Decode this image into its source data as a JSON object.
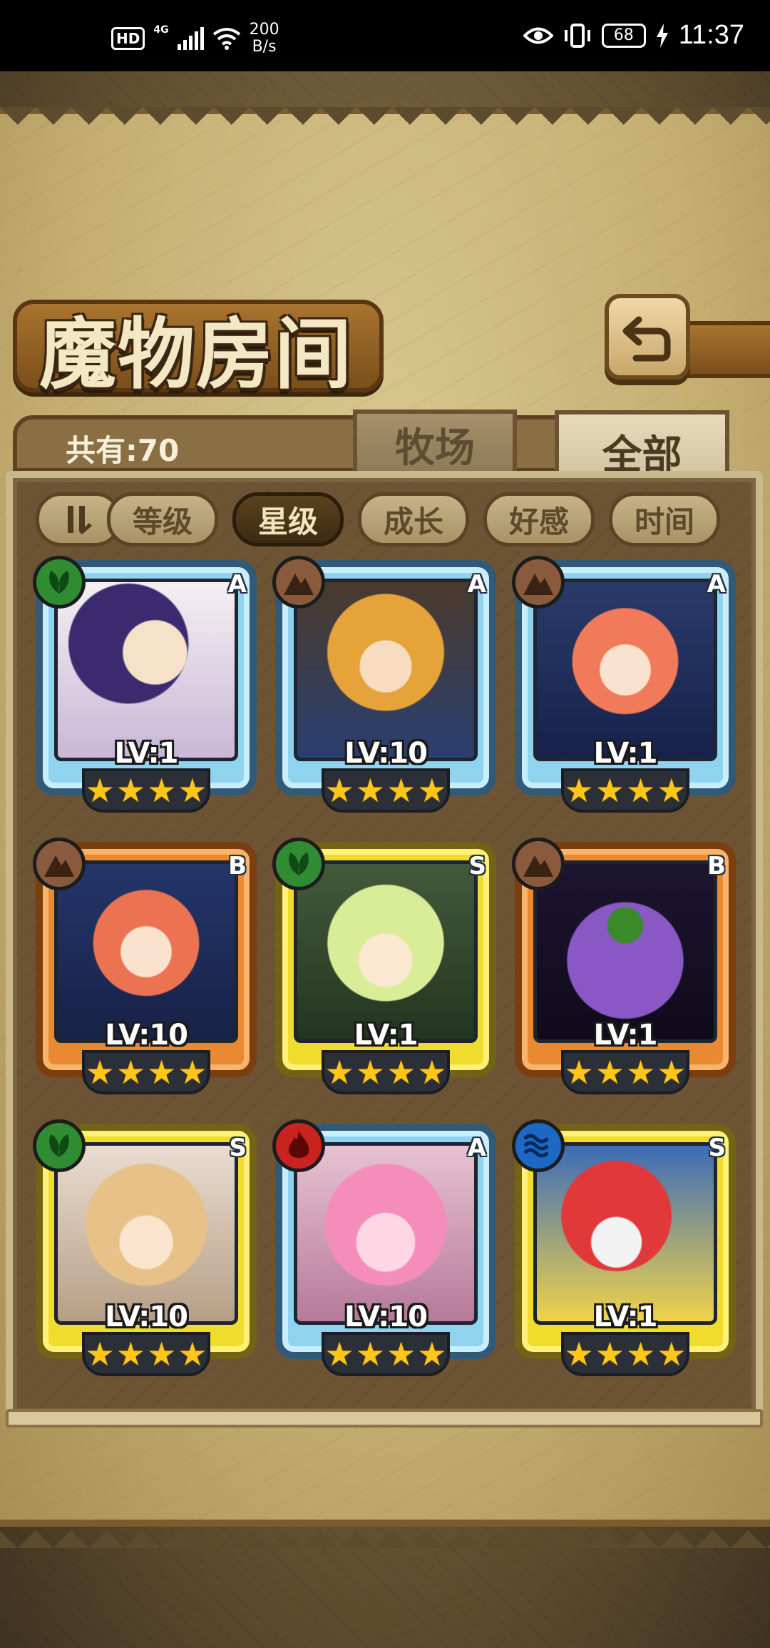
{
  "status_bar": {
    "hd": "HD",
    "network": "4G",
    "speed_value": "200",
    "speed_unit": "B/s",
    "battery": "68",
    "time": "11:37"
  },
  "header": {
    "title": "魔物房间",
    "back_icon": "return-arrow-icon"
  },
  "inventory": {
    "count_label": "共有:70"
  },
  "tabs": [
    {
      "label": "牧场",
      "active": false
    },
    {
      "label": "全部",
      "active": true
    }
  ],
  "sort": {
    "toggle_icon": "sort-order-icon",
    "buttons": [
      {
        "label": "等级",
        "active": false
      },
      {
        "label": "星级",
        "active": true
      },
      {
        "label": "成长",
        "active": false
      },
      {
        "label": "好感",
        "active": false
      },
      {
        "label": "时间",
        "active": false
      }
    ]
  },
  "monsters": [
    {
      "grade": "A",
      "element": "grass",
      "level": "LV:1",
      "stars": 4
    },
    {
      "grade": "A",
      "element": "earth",
      "level": "LV:10",
      "stars": 4
    },
    {
      "grade": "A",
      "element": "earth",
      "level": "LV:1",
      "stars": 4
    },
    {
      "grade": "B",
      "element": "earth",
      "level": "LV:10",
      "stars": 4
    },
    {
      "grade": "S",
      "element": "grass",
      "level": "LV:1",
      "stars": 4
    },
    {
      "grade": "B",
      "element": "earth",
      "level": "LV:1",
      "stars": 4
    },
    {
      "grade": "S",
      "element": "grass",
      "level": "LV:10",
      "stars": 4
    },
    {
      "grade": "A",
      "element": "fire",
      "level": "LV:10",
      "stars": 4
    },
    {
      "grade": "S",
      "element": "water",
      "level": "LV:1",
      "stars": 4
    }
  ],
  "colors": {
    "frame_A": "#8fd3ef",
    "frame_B": "#e98a33",
    "frame_S": "#f0dc2c",
    "star": "#ffc61a",
    "status_bar": "#000000"
  }
}
